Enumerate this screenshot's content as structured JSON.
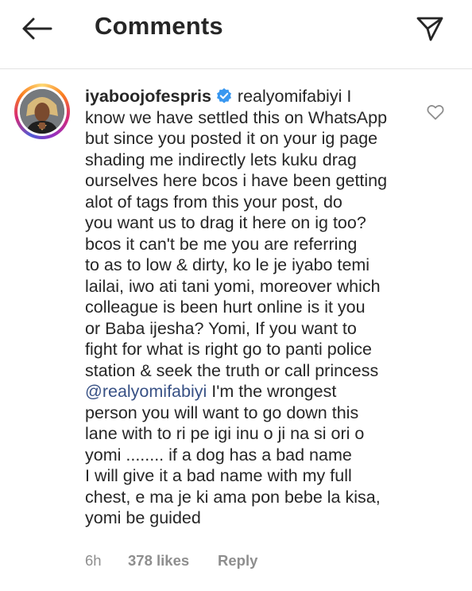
{
  "header": {
    "title": "Comments",
    "back_icon": "arrow-left-icon",
    "share_icon": "paper-plane-icon"
  },
  "comment": {
    "username": "iyaboojofespris",
    "verified": true,
    "lines": [
      "realyomifabiyi I",
      "know we have settled this on WhatsApp",
      "but since you posted it on your ig page",
      "shading me indirectly lets kuku drag",
      "ourselves here bcos i have been getting",
      "alot of tags from this your post, do",
      "you want us to drag it here on ig too?",
      "bcos it can't be me you are referring",
      "to as to low & dirty, ko le je iyabo temi",
      "lailai, iwo ati tani yomi, moreover which",
      "colleague is been hurt online is it you",
      "or Baba ijesha? Yomi, If you want to",
      "fight for what is right go to panti police",
      "station & seek the truth or call princess",
      "@realyomifabiyi",
      " I'm the wrongest",
      "person you will want to go down this",
      "lane with to ri pe igi inu o ji na si ori o",
      "yomi ........ if a dog has a bad  name",
      "I will give it a bad name with my full",
      "chest, e ma je ki ama pon bebe la kisa,",
      "yomi be guided"
    ],
    "time": "6h",
    "likes": "378 likes",
    "reply_label": "Reply",
    "like_icon": "heart-outline-icon"
  },
  "colors": {
    "text": "#262626",
    "muted": "#8e8e8e",
    "mention": "#385185",
    "verified": "#3897f0"
  }
}
